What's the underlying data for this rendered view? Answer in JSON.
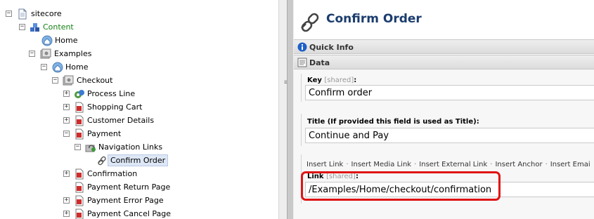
{
  "tree": {
    "nodes": [
      {
        "label": "sitecore",
        "icon": "document-icon",
        "toggle": "−",
        "color": "normal"
      },
      {
        "label": "Content",
        "icon": "content-cubes-icon",
        "toggle": "−",
        "color": "green"
      },
      {
        "label": "Home",
        "icon": "home-icon",
        "toggle": "",
        "color": "normal"
      },
      {
        "label": "Examples",
        "icon": "folder-gear-icon",
        "toggle": "−",
        "color": "normal"
      },
      {
        "label": "Home",
        "icon": "home-icon",
        "toggle": "−",
        "color": "normal"
      },
      {
        "label": "Checkout",
        "icon": "folder-gear-icon",
        "toggle": "−",
        "color": "normal"
      },
      {
        "label": "Process Line",
        "icon": "process-icon",
        "toggle": "+",
        "color": "normal"
      },
      {
        "label": "Shopping Cart",
        "icon": "page-red-icon",
        "toggle": "+",
        "color": "normal"
      },
      {
        "label": "Customer Details",
        "icon": "page-red-icon",
        "toggle": "+",
        "color": "normal"
      },
      {
        "label": "Payment",
        "icon": "page-red-icon",
        "toggle": "−",
        "color": "normal"
      },
      {
        "label": "Navigation Links",
        "icon": "links-icon",
        "toggle": "−",
        "color": "normal"
      },
      {
        "label": "Confirm Order",
        "icon": "chain-link-icon",
        "toggle": "",
        "color": "normal",
        "selected": true
      },
      {
        "label": "Confirmation",
        "icon": "page-red-icon",
        "toggle": "+",
        "color": "normal"
      },
      {
        "label": "Payment Return Page",
        "icon": "page-red-icon",
        "toggle": "",
        "color": "normal"
      },
      {
        "label": "Payment Error Page",
        "icon": "page-red-icon",
        "toggle": "+",
        "color": "normal"
      },
      {
        "label": "Payment Cancel Page",
        "icon": "page-red-icon",
        "toggle": "+",
        "color": "normal"
      }
    ]
  },
  "editor": {
    "title": "Confirm Order",
    "title_icon": "chain-link-icon",
    "sections": {
      "quick_info": {
        "label": "Quick Info",
        "icon": "info-icon"
      },
      "data": {
        "label": "Data",
        "icon": "data-page-icon"
      }
    },
    "fields": {
      "key": {
        "label": "Key",
        "shared": "[shared]",
        "suffix": ":",
        "value": "Confirm order"
      },
      "title": {
        "label": "Title (If provided this field is used as Title):",
        "value": "Continue and Pay"
      },
      "link": {
        "label": "Link",
        "shared": "[shared]",
        "suffix": ":",
        "value": "/Examples/Home/checkout/confirmation"
      }
    },
    "link_toolbar": {
      "insert_link": "Insert Link",
      "insert_media_link": "Insert Media Link",
      "insert_external_link": "Insert External Link",
      "insert_anchor": "Insert Anchor",
      "insert_email": "Insert Emai",
      "separator": "·"
    }
  },
  "colors": {
    "highlight": "#e01313",
    "title": "#1b3c6e",
    "content_label": "#148214",
    "selection": "#dde7f5"
  }
}
